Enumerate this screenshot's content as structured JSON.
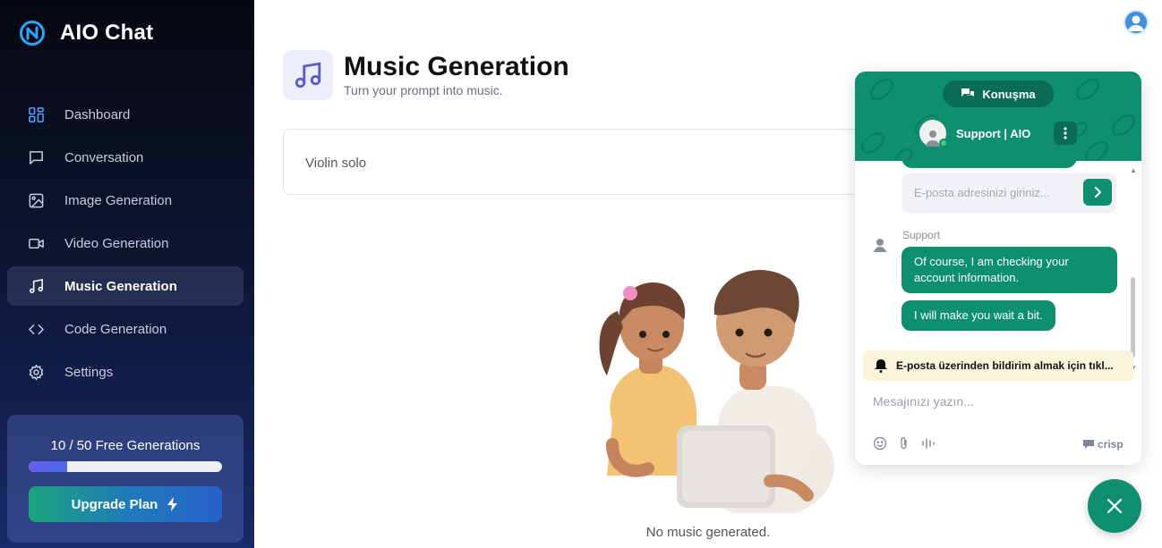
{
  "app": {
    "name": "AIO Chat"
  },
  "sidebar": {
    "items": [
      {
        "label": "Dashboard",
        "icon": "dashboard-grid-icon",
        "active": false
      },
      {
        "label": "Conversation",
        "icon": "chat-bubble-icon",
        "active": false
      },
      {
        "label": "Image Generation",
        "icon": "image-icon",
        "active": false
      },
      {
        "label": "Video Generation",
        "icon": "video-camera-icon",
        "active": false
      },
      {
        "label": "Music Generation",
        "icon": "music-note-icon",
        "active": true
      },
      {
        "label": "Code Generation",
        "icon": "code-brackets-icon",
        "active": false
      },
      {
        "label": "Settings",
        "icon": "gear-icon",
        "active": false
      }
    ],
    "plan": {
      "usage_text": "10 / 50 Free Generations",
      "used": 10,
      "total": 50,
      "upgrade_label": "Upgrade Plan"
    }
  },
  "main": {
    "title": "Music Generation",
    "subtitle": "Turn your prompt into music.",
    "prompt_value": "Violin solo",
    "empty_text": "No music generated."
  },
  "chat": {
    "tab_label": "Konuşma",
    "agent_name": "Support | AIO",
    "email_placeholder": "E-posta adresinizi giriniz...",
    "sender_label": "Support",
    "messages": [
      "Of course, I am checking your account information.",
      "I will make you wait a bit."
    ],
    "notify_text": "E-posta üzerinden bildirim almak için tıkl...",
    "compose_placeholder": "Mesajınızı yazın...",
    "brand": "crisp"
  },
  "colors": {
    "accent_green": "#0e8f6f",
    "sidebar_dark": "#060810",
    "sidebar_blue": "#172a6a",
    "music_icon": "#5b5bd6"
  }
}
